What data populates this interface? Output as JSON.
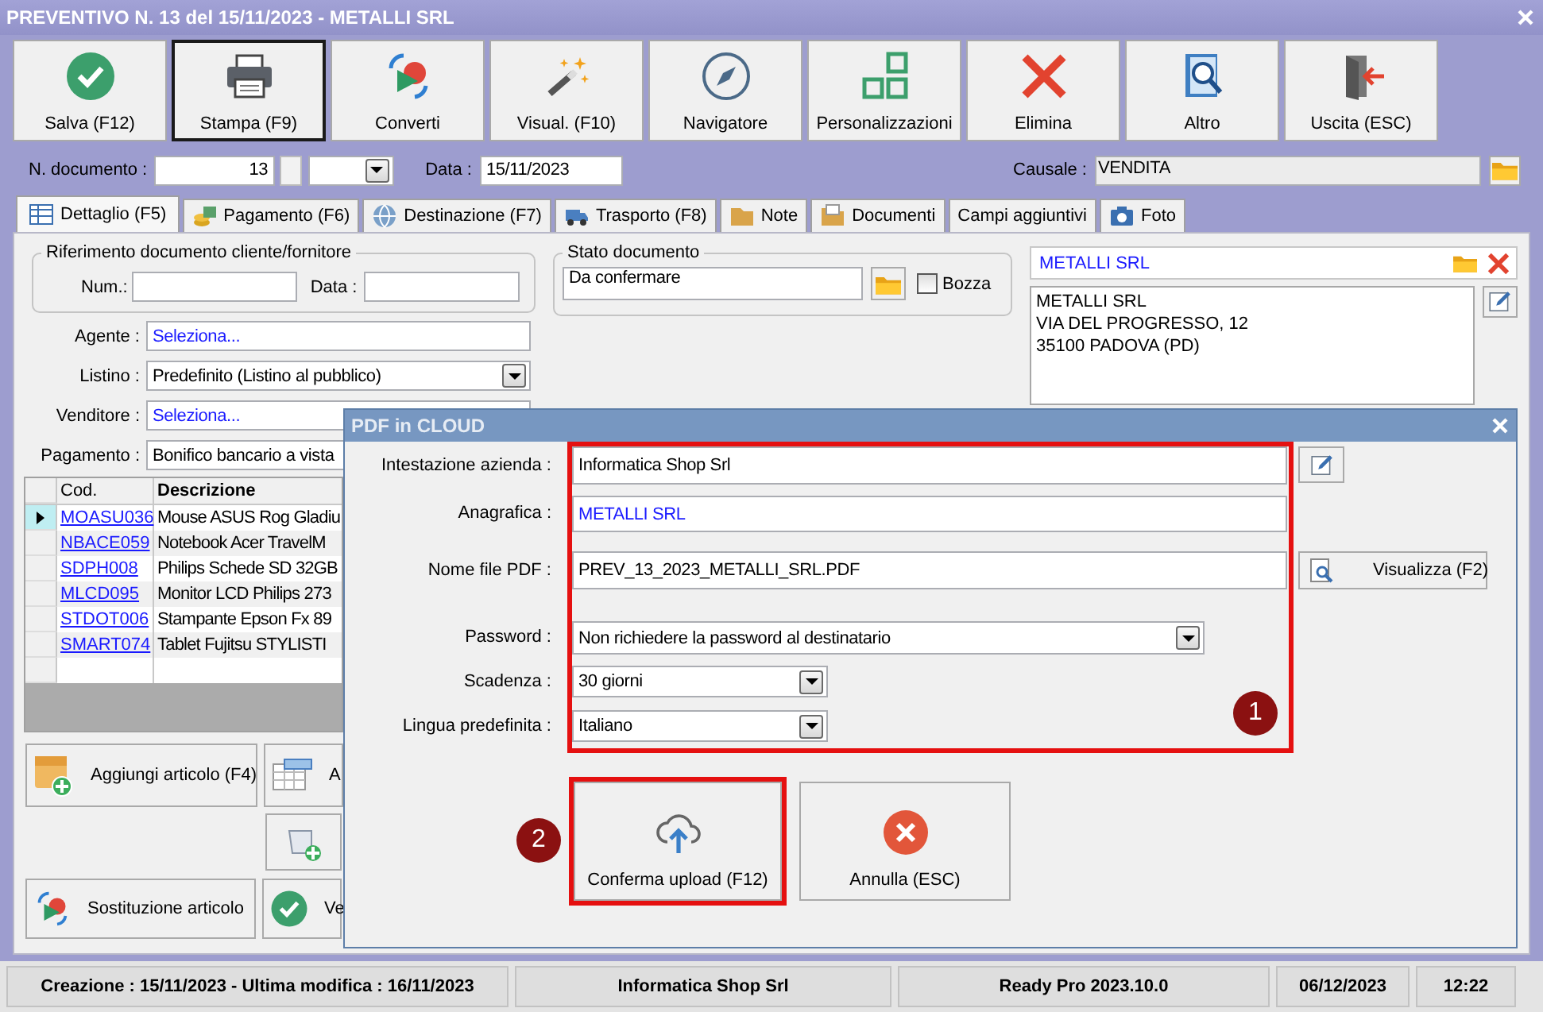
{
  "window": {
    "title": "PREVENTIVO N. 13 del 15/11/2023 - METALLI SRL"
  },
  "toolbar": [
    {
      "label": "Salva (F12)",
      "focused": false
    },
    {
      "label": "Stampa (F9)",
      "focused": true
    },
    {
      "label": "Converti",
      "focused": false
    },
    {
      "label": "Visual. (F10)",
      "focused": false
    },
    {
      "label": "Navigatore",
      "focused": false
    },
    {
      "label": "Personalizzazioni",
      "focused": false
    },
    {
      "label": "Elimina",
      "focused": false
    },
    {
      "label": "Altro",
      "focused": false
    },
    {
      "label": "Uscita (ESC)",
      "focused": false
    }
  ],
  "header": {
    "doc_number_label": "N. documento :",
    "doc_number": "13",
    "date_label": "Data :",
    "date": "15/11/2023",
    "causale_label": "Causale :",
    "causale": "VENDITA"
  },
  "tabs": [
    {
      "label": "Dettaglio (F5)",
      "selected": true
    },
    {
      "label": "Pagamento (F6)",
      "selected": false
    },
    {
      "label": "Destinazione (F7)",
      "selected": false
    },
    {
      "label": "Trasporto (F8)",
      "selected": false
    },
    {
      "label": "Note",
      "selected": false
    },
    {
      "label": "Documenti",
      "selected": false
    },
    {
      "label": "Campi aggiuntivi",
      "selected": false
    },
    {
      "label": "Foto",
      "selected": false
    }
  ],
  "reference": {
    "legend": "Riferimento documento cliente/fornitore",
    "num_label": "Num.:",
    "date_label": "Data :"
  },
  "fields": [
    {
      "label": "Agente :",
      "value": "Seleziona...",
      "kind": "link"
    },
    {
      "label": "Listino :",
      "value": "Predefinito (Listino al pubblico)",
      "kind": "combo"
    },
    {
      "label": "Venditore :",
      "value": "Seleziona...",
      "kind": "link"
    },
    {
      "label": "Pagamento :",
      "value": "Bonifico bancario a vista",
      "kind": "text"
    }
  ],
  "document_status": {
    "legend": "Stato documento",
    "value": "Da confermare",
    "draft_label": "Bozza",
    "draft_checked": false
  },
  "customer": {
    "name": "METALLI SRL",
    "address": [
      "METALLI SRL",
      "VIA DEL PROGRESSO, 12",
      "35100 PADOVA (PD)"
    ]
  },
  "table": {
    "columns": [
      {
        "label": "Cod.",
        "sorted": false
      },
      {
        "label": "Descrizione",
        "sorted": true
      }
    ],
    "rows": [
      {
        "code": "MOASU036",
        "description": "Mouse ASUS Rog Gladiu",
        "selected": true
      },
      {
        "code": "NBACE059",
        "description": "Notebook Acer TravelM",
        "selected": false
      },
      {
        "code": "SDPH008",
        "description": "Philips Schede SD 32GB",
        "selected": false
      },
      {
        "code": "MLCD095",
        "description": "Monitor LCD Philips 273",
        "selected": false
      },
      {
        "code": "STDOT006",
        "description": "Stampante Epson Fx 89",
        "selected": false
      },
      {
        "code": "SMART074",
        "description": "Tablet Fujitsu STYLISTI",
        "selected": false
      }
    ]
  },
  "actions": [
    {
      "label": "Aggiungi articolo (F4)"
    },
    {
      "label": "A"
    },
    {
      "label": "Sostituzione articolo"
    },
    {
      "label": "Ve"
    }
  ],
  "dialog": {
    "title": "PDF in CLOUD",
    "fields": [
      {
        "label": "Intestazione azienda :",
        "value": "Informatica Shop Srl",
        "kind": "text"
      },
      {
        "label": "Anagrafica :",
        "value": "METALLI SRL",
        "kind": "link"
      },
      {
        "label": "Nome file PDF :",
        "value": "PREV_13_2023_METALLI_SRL.PDF",
        "kind": "text"
      },
      {
        "label": "Password :",
        "value": "Non richiedere la password al destinatario",
        "kind": "combo"
      },
      {
        "label": "Scadenza :",
        "value": "30 giorni",
        "kind": "combo"
      },
      {
        "label": "Lingua predefinita :",
        "value": "Italiano",
        "kind": "combo"
      }
    ],
    "preview_button": "Visualizza (F2)",
    "buttons": [
      {
        "label": "Conferma upload (F12)"
      },
      {
        "label": "Annulla (ESC)"
      }
    ],
    "callouts": [
      "1",
      "2"
    ]
  },
  "status_bar": [
    "Creazione : 15/11/2023 - Ultima modifica : 16/11/2023",
    "Informatica Shop Srl",
    "Ready Pro 2023.10.0",
    "06/12/2023",
    "12:22"
  ]
}
